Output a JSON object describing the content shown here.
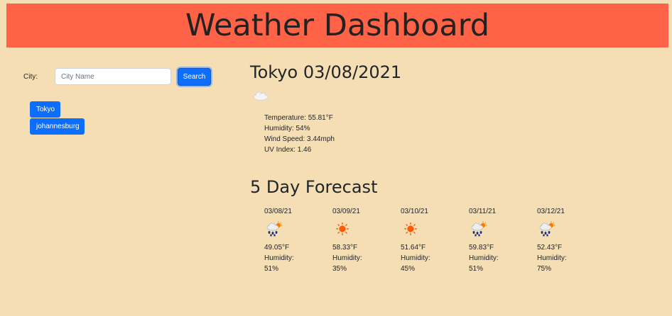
{
  "header": {
    "title": "Weather Dashboard"
  },
  "search": {
    "label": "City:",
    "placeholder": "City Name",
    "value": "",
    "button_label": "Search"
  },
  "history": [
    "Tokyo",
    "johannesburg"
  ],
  "current": {
    "title": "Tokyo 03/08/2021",
    "icon": "cloud-icon",
    "temperature": "Temperature: 55.81°F",
    "humidity": "Humidity: 54%",
    "wind": "Wind Speed: 3.44mph",
    "uv": "UV Index: 1.46"
  },
  "forecast": {
    "title": "5 Day Forecast",
    "days": [
      {
        "date": "03/08/21",
        "icon": "rain-sun-icon",
        "temp": "49.05°F",
        "humidity_label": "Humidity:",
        "humidity": "51%"
      },
      {
        "date": "03/09/21",
        "icon": "sun-icon",
        "temp": "58.33°F",
        "humidity_label": "Humidity:",
        "humidity": "35%"
      },
      {
        "date": "03/10/21",
        "icon": "sun-icon",
        "temp": "51.64°F",
        "humidity_label": "Humidity:",
        "humidity": "45%"
      },
      {
        "date": "03/11/21",
        "icon": "rain-sun-icon",
        "temp": "59.83°F",
        "humidity_label": "Humidity:",
        "humidity": "51%"
      },
      {
        "date": "03/12/21",
        "icon": "rain-sun-icon",
        "temp": "52.43°F",
        "humidity_label": "Humidity:",
        "humidity": "75%"
      }
    ]
  },
  "colors": {
    "page_background": "#f5deb3",
    "header_background": "#ff6347",
    "button_primary": "#0d6efd"
  }
}
